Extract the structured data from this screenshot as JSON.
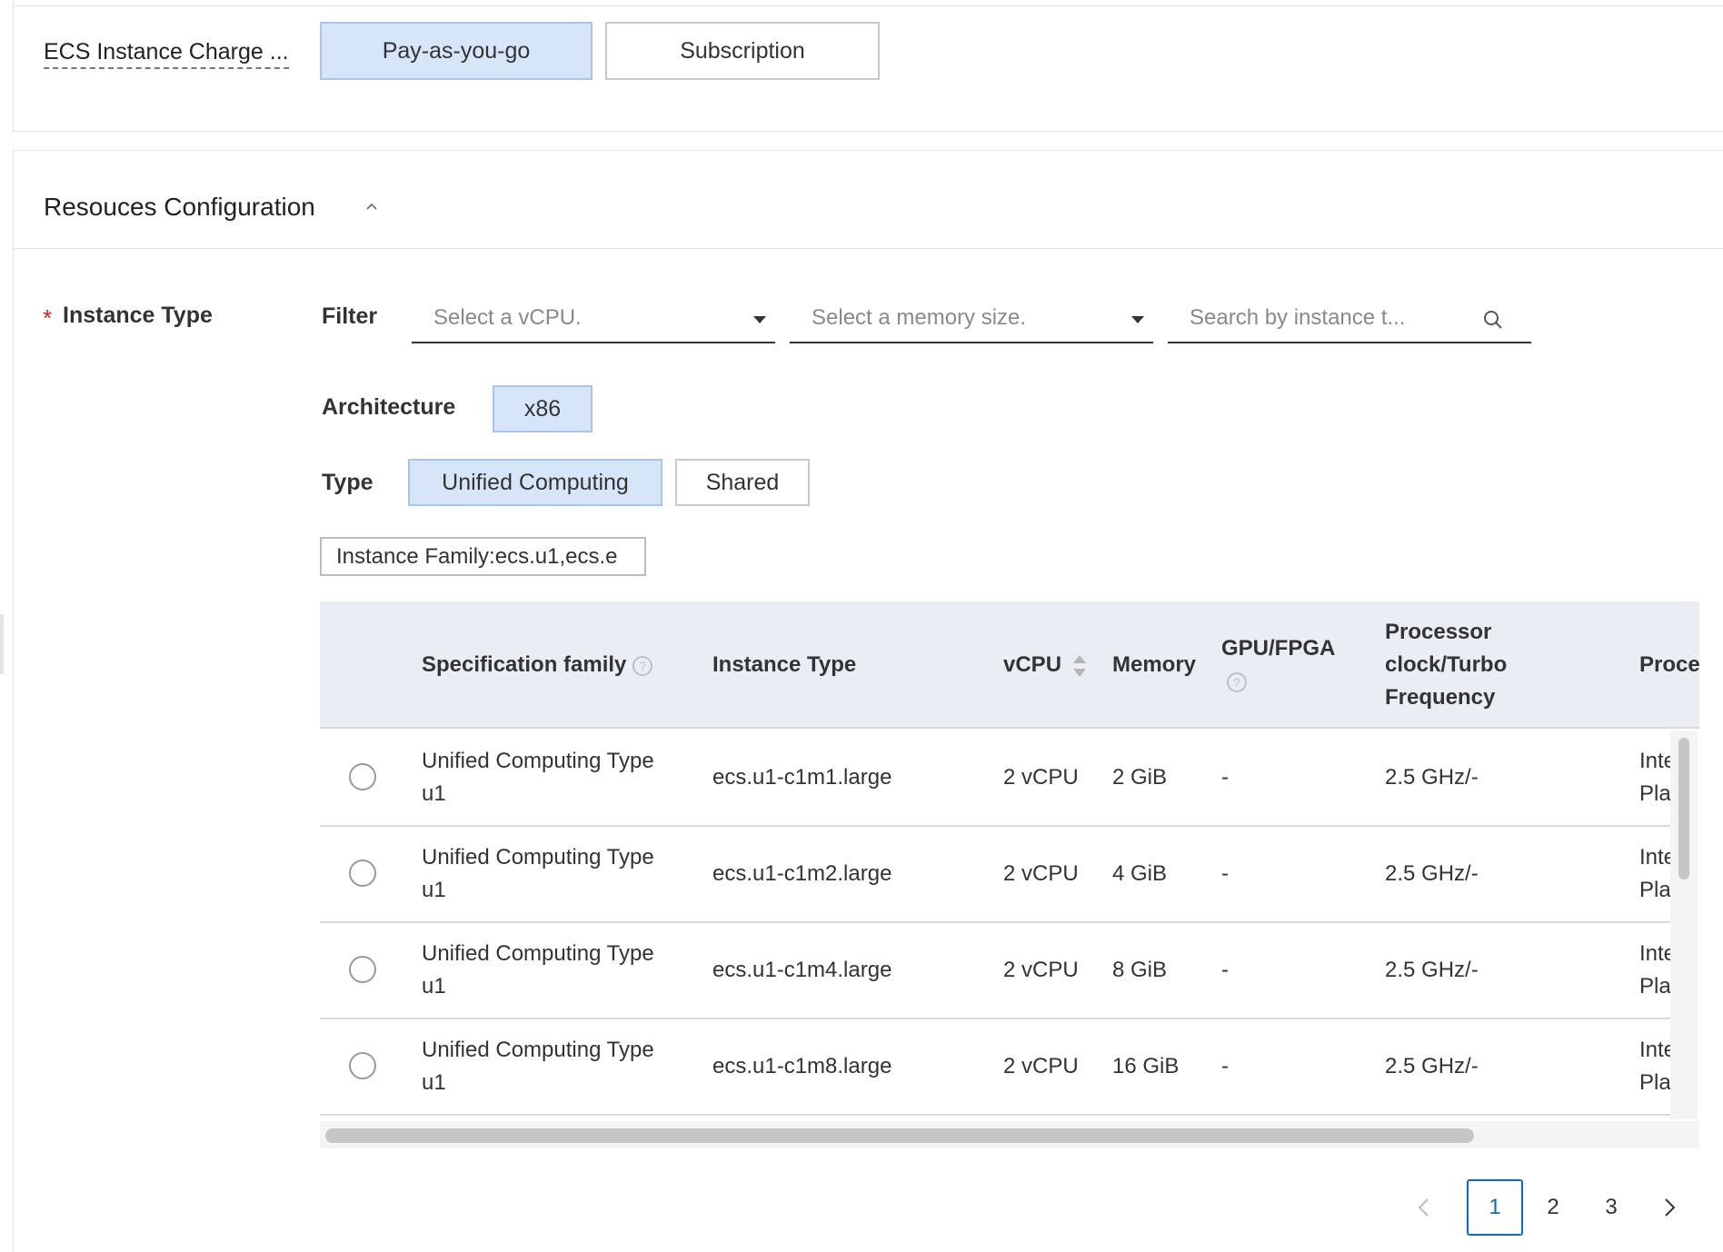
{
  "charge": {
    "label": "ECS Instance Charge ...",
    "options": [
      "Pay-as-you-go",
      "Subscription"
    ],
    "selected": "Pay-as-you-go"
  },
  "resources": {
    "title": "Resouces Configuration",
    "collapse_icon": "chevron-up-icon"
  },
  "instance_type": {
    "label": "Instance Type",
    "required_mark": "*",
    "filter_label": "Filter",
    "vcpu_placeholder": "Select a vCPU.",
    "memory_placeholder": "Select a memory size.",
    "search_placeholder": "Search by instance t...",
    "architecture_label": "Architecture",
    "architecture_options": [
      "x86"
    ],
    "type_label": "Type",
    "type_options": [
      "Unified Computing",
      "Shared"
    ],
    "family_tag": "Instance Family:ecs.u1,ecs.e"
  },
  "table": {
    "headers": {
      "spec_family": "Specification family",
      "instance_type": "Instance Type",
      "vcpu": "vCPU",
      "memory": "Memory",
      "gpu_fpga": "GPU/FPGA",
      "processor_line1": "Processor",
      "processor_line2": "clock/Turbo",
      "processor_line3": "Frequency",
      "proc_model": "Proce"
    },
    "rows": [
      {
        "family_line1": "Unified Computing Type",
        "family_line2": "u1",
        "type": "ecs.u1-c1m1.large",
        "vcpu": "2 vCPU",
        "memory": "2 GiB",
        "gpu": "-",
        "freq": "2.5 GHz/-",
        "proc_line1": "Inte",
        "proc_line2": "Pla"
      },
      {
        "family_line1": "Unified Computing Type",
        "family_line2": "u1",
        "type": "ecs.u1-c1m2.large",
        "vcpu": "2 vCPU",
        "memory": "4 GiB",
        "gpu": "-",
        "freq": "2.5 GHz/-",
        "proc_line1": "Inte",
        "proc_line2": "Pla"
      },
      {
        "family_line1": "Unified Computing Type",
        "family_line2": "u1",
        "type": "ecs.u1-c1m4.large",
        "vcpu": "2 vCPU",
        "memory": "8 GiB",
        "gpu": "-",
        "freq": "2.5 GHz/-",
        "proc_line1": "Inte",
        "proc_line2": "Pla"
      },
      {
        "family_line1": "Unified Computing Type",
        "family_line2": "u1",
        "type": "ecs.u1-c1m8.large",
        "vcpu": "2 vCPU",
        "memory": "16 GiB",
        "gpu": "-",
        "freq": "2.5 GHz/-",
        "proc_line1": "Inte",
        "proc_line2": "Pla"
      }
    ]
  },
  "pagination": {
    "pages": [
      "1",
      "2",
      "3"
    ],
    "current": "1"
  },
  "colors": {
    "accent": "#0b6bcb",
    "selected_bg": "#d6e5f7",
    "header_bg": "#eaeef4",
    "required": "#e02020"
  }
}
